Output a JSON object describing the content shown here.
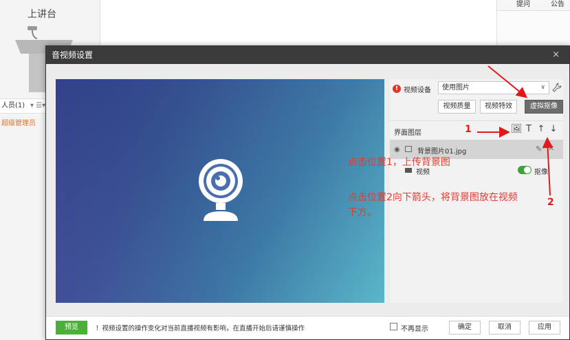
{
  "background": {
    "stage_title": "上讲台",
    "people_label": "人员(1)",
    "people_controls": "▾ ☰▾",
    "admin_label": "超级管理员",
    "right_tabs": [
      "提问",
      "公告"
    ]
  },
  "dialog": {
    "title": "音视频设置",
    "close": "×",
    "device": {
      "label": "视频设备",
      "selected": "使用图片",
      "arrow": "∨"
    },
    "buttons": {
      "quality": "视频质量",
      "effects": "视频特效",
      "virtual": "虚拟抠像"
    },
    "layers": {
      "label": "界面图层",
      "tools": [
        "🖼",
        "T",
        "↑",
        "↓"
      ],
      "items": [
        {
          "name": "背景图片01.jpg"
        },
        {
          "name": "视频",
          "toggle_label": "抠像"
        }
      ]
    },
    "annotations": {
      "num1": "1",
      "num2": "2",
      "note1": "点击位置1，上传背景图",
      "note2": "点击位置2向下箭头，将背景图放在视频下方。"
    },
    "footer": {
      "preview": "预览",
      "note": "！视频设置的操作变化对当前直播视频有影响，在直播开始后请谨慎操作",
      "no_show": "不再显示",
      "ok": "确定",
      "cancel": "取消",
      "apply": "应用"
    }
  },
  "colors": {
    "annotation_red": "#e01919",
    "preview_green": "#4caf3a",
    "toggle_green": "#3aa33a"
  }
}
